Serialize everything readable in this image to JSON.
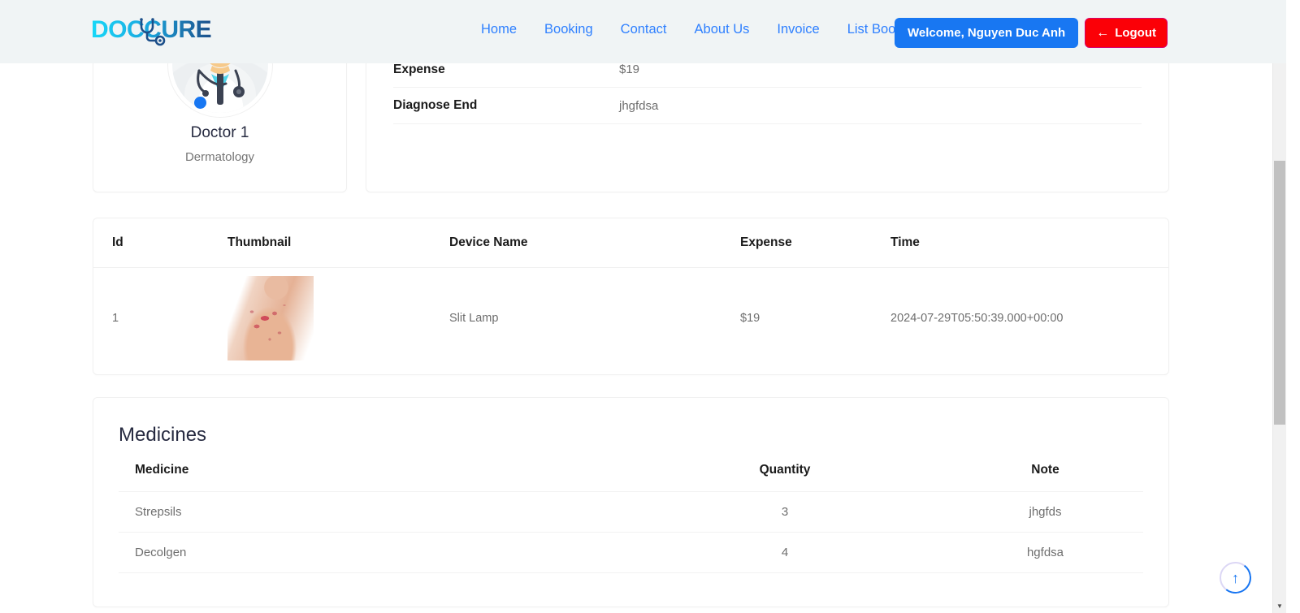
{
  "header": {
    "logo_text": "DOCCURE",
    "logo_icon": "stethoscope-icon",
    "nav": [
      {
        "label": "Home"
      },
      {
        "label": "Booking"
      },
      {
        "label": "Contact"
      },
      {
        "label": "About Us"
      },
      {
        "label": "Invoice"
      },
      {
        "label": "List Booking"
      }
    ],
    "welcome_label": "Welcome, Nguyen Duc Anh",
    "logout_label": "Logout",
    "logout_icon": "arrow-left-icon",
    "accent_blue": "#1877f2",
    "logout_red": "#fb0007",
    "background": "#f0f4f5"
  },
  "doctor": {
    "name": "Doctor 1",
    "specialty": "Dermatology",
    "avatar_icon": "doctor-avatar",
    "status_icon": "online-status-dot"
  },
  "details": {
    "rows": [
      {
        "label": "Expense",
        "value": "$19"
      },
      {
        "label": "Diagnose End",
        "value": "jhgfdsa"
      }
    ]
  },
  "devices": {
    "columns": [
      "Id",
      "Thumbnail",
      "Device Name",
      "Expense",
      "Time"
    ],
    "rows": [
      {
        "id": "1",
        "thumbnail_alt": "skin-condition-photo",
        "device_name": "Slit Lamp",
        "expense": "$19",
        "time": "2024-07-29T05:50:39.000+00:00"
      }
    ]
  },
  "medicines": {
    "title": "Medicines",
    "columns": [
      "Medicine",
      "Quantity",
      "Note"
    ],
    "rows": [
      {
        "medicine": "Strepsils",
        "quantity": "3",
        "note": "jhgfds"
      },
      {
        "medicine": "Decolgen",
        "quantity": "4",
        "note": "hgfdsa"
      }
    ]
  },
  "scroll_top": {
    "icon": "arrow-up-icon"
  }
}
